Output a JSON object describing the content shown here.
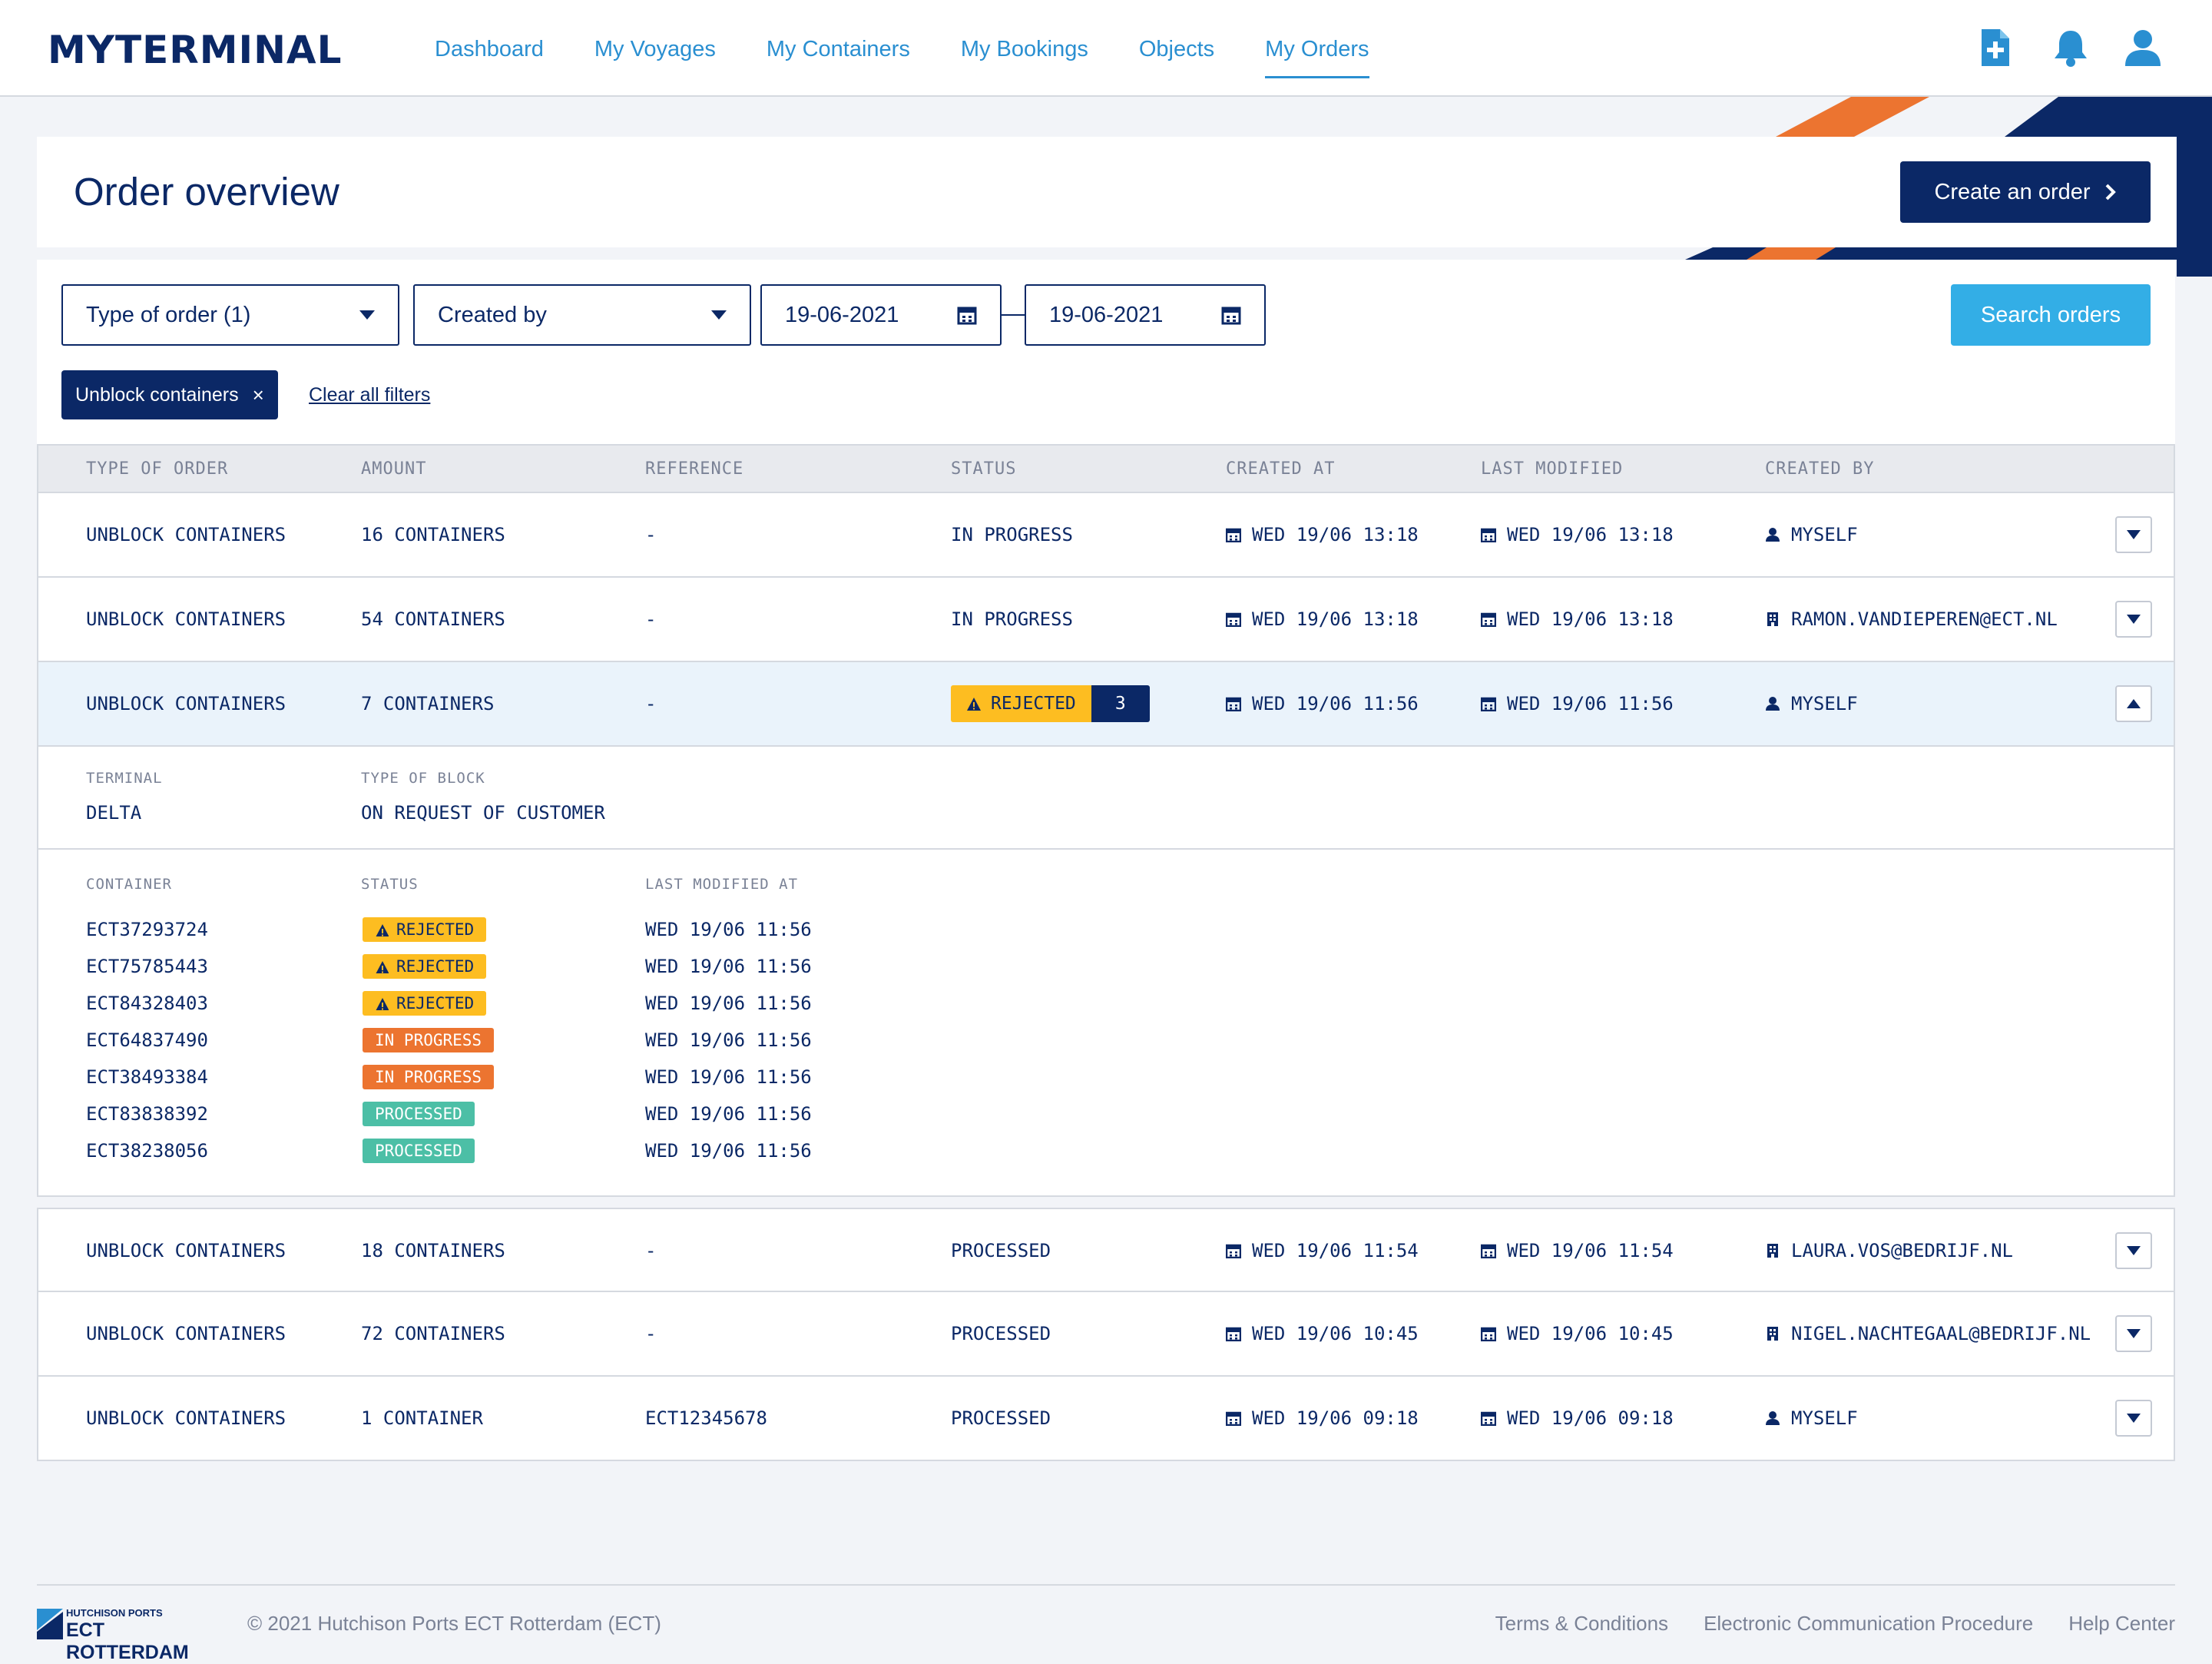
{
  "brand": {
    "logo_text": "MYTERMINAL",
    "accent": "#0b2866",
    "link_blue": "#2a8fd1",
    "orange": "#ec7430"
  },
  "nav": {
    "items": [
      {
        "label": "Dashboard",
        "active": false
      },
      {
        "label": "My Voyages",
        "active": false
      },
      {
        "label": "My Containers",
        "active": false
      },
      {
        "label": "My Bookings",
        "active": false
      },
      {
        "label": "Objects",
        "active": false
      },
      {
        "label": "My Orders",
        "active": true
      }
    ],
    "icons": [
      "new-document-icon",
      "bell-icon",
      "user-icon"
    ]
  },
  "page": {
    "title": "Order overview",
    "create_button": "Create an order"
  },
  "filters": {
    "type_of_order": "Type of order (1)",
    "created_by": "Created by",
    "date_from": "19-06-2021",
    "date_to": "19-06-2021",
    "search_button": "Search orders",
    "active_chip": "Unblock containers",
    "chip_remove": "×",
    "clear_all": "Clear all filters"
  },
  "table": {
    "columns": [
      "TYPE OF ORDER",
      "AMOUNT",
      "REFERENCE",
      "STATUS",
      "CREATED AT",
      "LAST MODIFIED",
      "CREATED BY"
    ],
    "rows": [
      {
        "type": "UNBLOCK CONTAINERS",
        "amount": "16 CONTAINERS",
        "reference": "-",
        "status": "IN PROGRESS",
        "created_at": "WED 19/06 13:18",
        "last_modified": "WED 19/06 13:18",
        "created_by": "MYSELF",
        "creator_kind": "person"
      },
      {
        "type": "UNBLOCK CONTAINERS",
        "amount": "54 CONTAINERS",
        "reference": "-",
        "status": "IN PROGRESS",
        "created_at": "WED 19/06 13:18",
        "last_modified": "WED 19/06 13:18",
        "created_by": "RAMON.VANDIEPEREN@ECT.NL",
        "creator_kind": "company"
      },
      {
        "type": "UNBLOCK CONTAINERS",
        "amount": "7 CONTAINERS",
        "reference": "-",
        "status": "REJECTED",
        "status_count": "3",
        "created_at": "WED 19/06 11:56",
        "last_modified": "WED 19/06 11:56",
        "created_by": "MYSELF",
        "creator_kind": "person",
        "expanded": true
      },
      {
        "type": "UNBLOCK CONTAINERS",
        "amount": "18 CONTAINERS",
        "reference": "-",
        "status": "PROCESSED",
        "created_at": "WED 19/06 11:54",
        "last_modified": "WED 19/06 11:54",
        "created_by": "LAURA.VOS@BEDRIJF.NL",
        "creator_kind": "company"
      },
      {
        "type": "UNBLOCK CONTAINERS",
        "amount": "72 CONTAINERS",
        "reference": "-",
        "status": "PROCESSED",
        "created_at": "WED 19/06 10:45",
        "last_modified": "WED 19/06 10:45",
        "created_by": "NIGEL.NACHTEGAAL@BEDRIJF.NL",
        "creator_kind": "company"
      },
      {
        "type": "UNBLOCK CONTAINERS",
        "amount": "1 CONTAINER",
        "reference": "ECT12345678",
        "status": "PROCESSED",
        "created_at": "WED 19/06 09:18",
        "last_modified": "WED 19/06 09:18",
        "created_by": "MYSELF",
        "creator_kind": "person"
      }
    ]
  },
  "detail": {
    "terminal_label": "TERMINAL",
    "terminal_value": "DELTA",
    "block_label": "TYPE OF BLOCK",
    "block_value": "ON REQUEST OF CUSTOMER",
    "list_headers": [
      "CONTAINER",
      "STATUS",
      "LAST MODIFIED AT"
    ],
    "containers": [
      {
        "id": "ECT37293724",
        "status": "REJECTED",
        "kind": "rejected",
        "modified": "WED 19/06 11:56"
      },
      {
        "id": "ECT75785443",
        "status": "REJECTED",
        "kind": "rejected",
        "modified": "WED 19/06 11:56"
      },
      {
        "id": "ECT84328403",
        "status": "REJECTED",
        "kind": "rejected",
        "modified": "WED 19/06 11:56"
      },
      {
        "id": "ECT64837490",
        "status": "IN PROGRESS",
        "kind": "progress",
        "modified": "WED 19/06 11:56"
      },
      {
        "id": "ECT38493384",
        "status": "IN PROGRESS",
        "kind": "progress",
        "modified": "WED 19/06 11:56"
      },
      {
        "id": "ECT83838392",
        "status": "PROCESSED",
        "kind": "processed",
        "modified": "WED 19/06 11:56"
      },
      {
        "id": "ECT38238056",
        "status": "PROCESSED",
        "kind": "processed",
        "modified": "WED 19/06 11:56"
      }
    ]
  },
  "footer": {
    "logo_top": "HUTCHISON PORTS",
    "logo_main": "ECT ROTTERDAM",
    "copyright": "© 2021 Hutchison Ports ECT Rotterdam (ECT)",
    "links": [
      "Terms & Conditions",
      "Electronic Communication Procedure",
      "Help Center"
    ]
  }
}
